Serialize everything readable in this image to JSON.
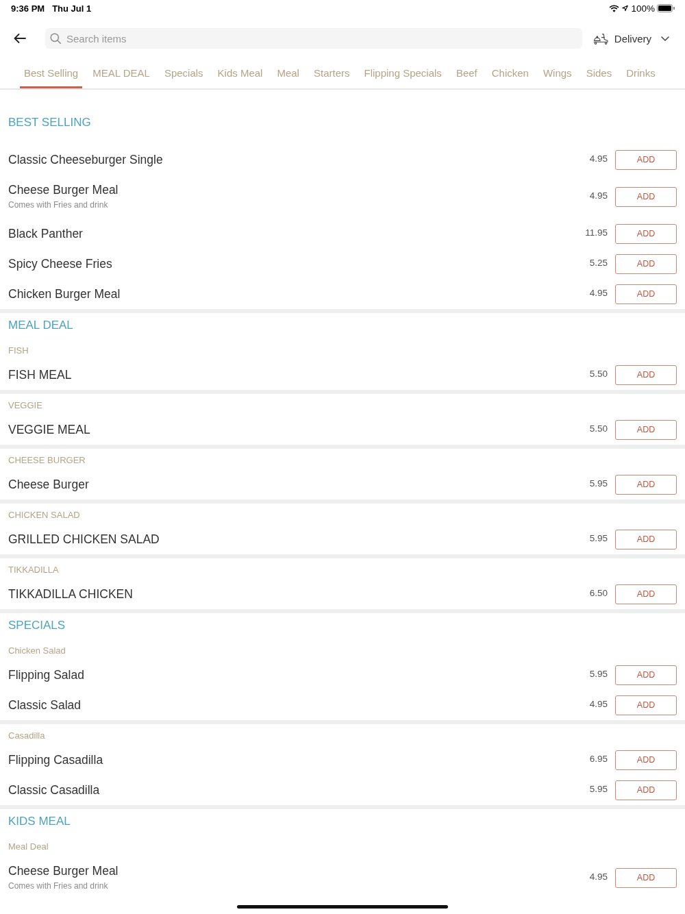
{
  "status_bar": {
    "time": "9:36 PM",
    "date": "Thu Jul 1",
    "battery": "100%"
  },
  "header": {
    "search": {
      "placeholder": "Search items"
    },
    "order_type": "Delivery"
  },
  "tabs": [
    {
      "label": "Best Selling",
      "selected": true
    },
    {
      "label": "MEAL DEAL",
      "selected": false
    },
    {
      "label": "Specials",
      "selected": false
    },
    {
      "label": "Kids Meal",
      "selected": false
    },
    {
      "label": "Meal",
      "selected": false
    },
    {
      "label": "Starters",
      "selected": false
    },
    {
      "label": "Flipping Specials",
      "selected": false
    },
    {
      "label": "Beef",
      "selected": false
    },
    {
      "label": "Chicken",
      "selected": false
    },
    {
      "label": "Wings",
      "selected": false
    },
    {
      "label": "Sides",
      "selected": false
    },
    {
      "label": "Drinks",
      "selected": false
    }
  ],
  "sections": [
    {
      "title": "BEST SELLING",
      "groups": [
        {
          "items": [
            {
              "name": "Classic Cheeseburger Single",
              "price": "4.95",
              "action": "ADD"
            },
            {
              "name": "Cheese Burger Meal",
              "description": "Comes with Fries and drink",
              "price": "4.95",
              "action": "ADD"
            },
            {
              "name": "Black Panther",
              "price": "11.95",
              "action": "ADD"
            },
            {
              "name": "Spicy Cheese Fries",
              "price": "5.25",
              "action": "ADD"
            },
            {
              "name": "Chicken Burger Meal",
              "price": "4.95",
              "action": "ADD"
            }
          ]
        }
      ]
    },
    {
      "title": "MEAL DEAL",
      "groups": [
        {
          "label": "FISH",
          "items": [
            {
              "name": "FISH MEAL",
              "price": "5.50",
              "action": "ADD"
            }
          ]
        },
        {
          "label": "VEGGIE",
          "items": [
            {
              "name": "VEGGIE MEAL",
              "price": "5.50",
              "action": "ADD"
            }
          ]
        },
        {
          "label": "CHEESE BURGER",
          "items": [
            {
              "name": "Cheese Burger",
              "price": "5.95",
              "action": "ADD"
            }
          ]
        },
        {
          "label": "CHICKEN SALAD",
          "items": [
            {
              "name": "GRILLED CHICKEN SALAD",
              "price": "5.95",
              "action": "ADD"
            }
          ]
        },
        {
          "label": "TIKKADILLA",
          "items": [
            {
              "name": "TIKKADILLA CHICKEN",
              "price": "6.50",
              "action": "ADD"
            }
          ]
        }
      ]
    },
    {
      "title": "SPECIALS",
      "groups": [
        {
          "label": "Chicken Salad",
          "items": [
            {
              "name": "Flipping Salad",
              "price": "5.95",
              "action": "ADD"
            },
            {
              "name": "Classic Salad",
              "price": "4.95",
              "action": "ADD"
            }
          ]
        },
        {
          "label": "Casadilla",
          "items": [
            {
              "name": "Flipping Casadilla",
              "price": "6.95",
              "action": "ADD"
            },
            {
              "name": "Classic Casadilla",
              "price": "5.95",
              "action": "ADD"
            }
          ]
        }
      ]
    },
    {
      "title": "KIDS MEAL",
      "groups": [
        {
          "label": "Meal Deal",
          "items": [
            {
              "name": "Cheese Burger Meal",
              "description": "Comes with Fries and drink",
              "price": "4.95",
              "action": "ADD"
            }
          ]
        }
      ]
    }
  ]
}
